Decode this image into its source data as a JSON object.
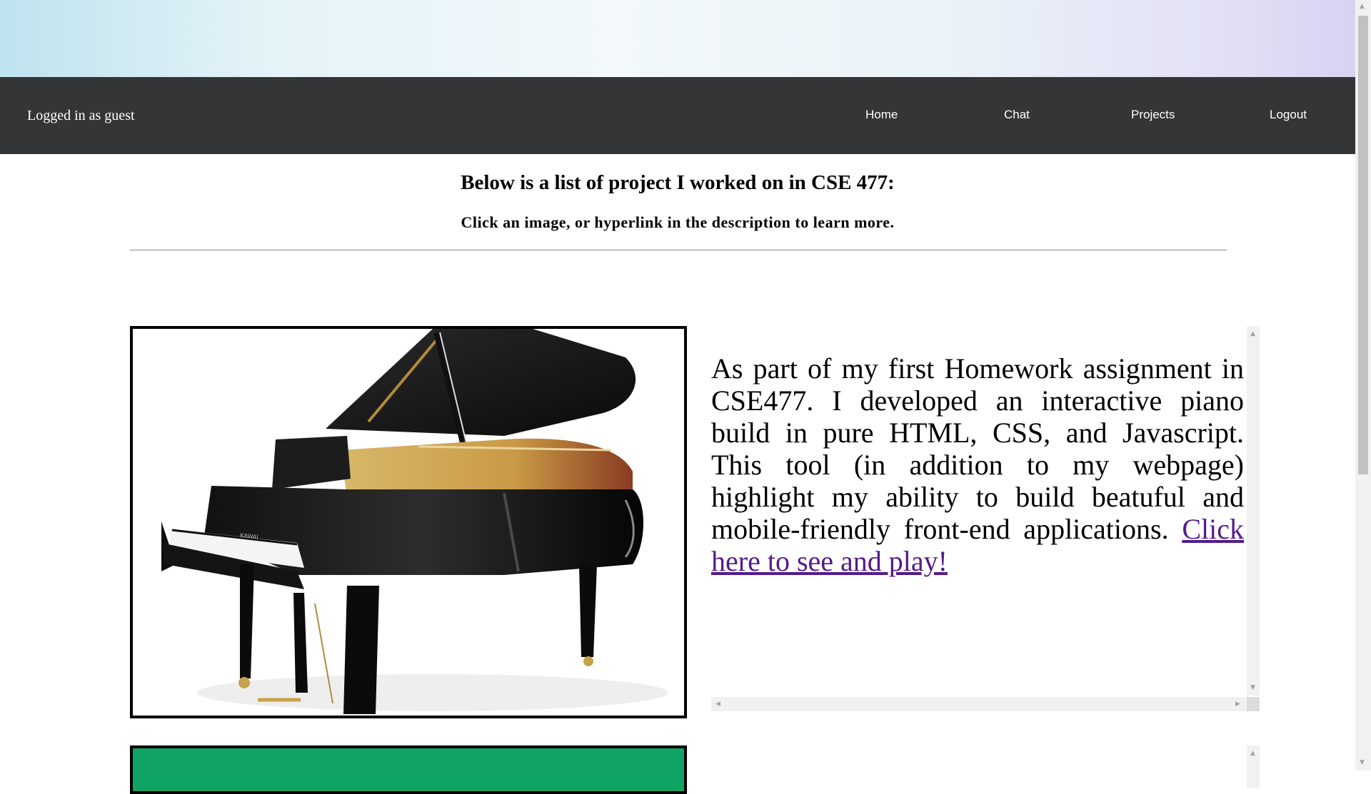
{
  "header": {
    "login_status": "Logged in as guest",
    "nav": {
      "home": "Home",
      "chat": "Chat",
      "projects": "Projects",
      "logout": "Logout"
    }
  },
  "main": {
    "heading": "Below is a list of project I worked on in CSE 477:",
    "subheading": "Click an image, or hyperlink in the description to learn more."
  },
  "projects": [
    {
      "image": "grand-piano-photo",
      "description": "As part of my first Homework assignment in CSE477. I developed an interactive piano build in pure HTML, CSS, and Javascript. This tool (in addition to my webpage) highlight my ability to build beatuful and mobile-friendly front-end applications.",
      "link_text": "Click here to see and play!"
    },
    {
      "image": "green-project-thumbnail"
    }
  ],
  "colors": {
    "navbar": "#343537",
    "link_visited": "#551a8b",
    "project2_bg": "#0fa463"
  }
}
